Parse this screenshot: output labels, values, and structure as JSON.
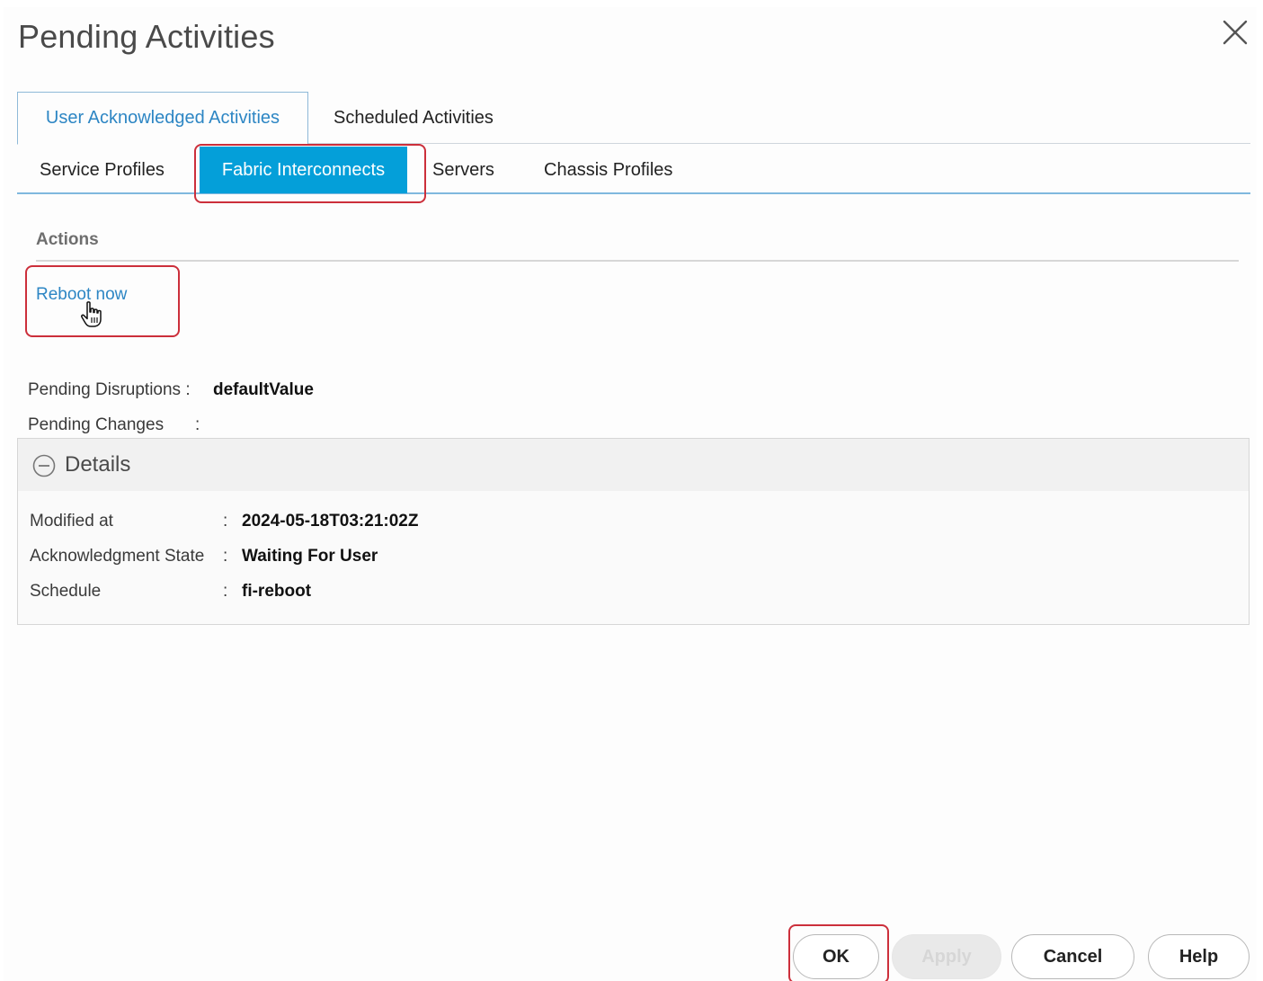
{
  "dialog": {
    "title": "Pending Activities"
  },
  "top_tabs": [
    {
      "label": "User Acknowledged Activities",
      "active": true
    },
    {
      "label": "Scheduled Activities",
      "active": false
    }
  ],
  "sub_tabs": [
    {
      "label": "Service Profiles",
      "active": false
    },
    {
      "label": "Fabric Interconnects",
      "active": true
    },
    {
      "label": "Servers",
      "active": false
    },
    {
      "label": "Chassis Profiles",
      "active": false
    }
  ],
  "actions": {
    "label": "Actions",
    "reboot_link": "Reboot now"
  },
  "pending": {
    "disruptions_label": "Pending Disruptions",
    "disruptions_value": "defaultValue",
    "changes_label": "Pending Changes",
    "colon": ":"
  },
  "details": {
    "title": "Details",
    "rows": [
      {
        "label": "Modified at",
        "value": "2024-05-18T03:21:02Z"
      },
      {
        "label": "Acknowledgment State",
        "value": "Waiting For User"
      },
      {
        "label": "Schedule",
        "value": "fi-reboot"
      }
    ]
  },
  "buttons": {
    "ok": "OK",
    "apply": "Apply",
    "cancel": "Cancel",
    "help": "Help"
  },
  "colors": {
    "accent": "#049fd9",
    "link": "#2d86c4",
    "highlight": "#cc2f3b"
  },
  "icons": {
    "close": "close-icon",
    "details_toggle": "collapse-circle-icon",
    "cursor": "hand-pointer-icon"
  }
}
